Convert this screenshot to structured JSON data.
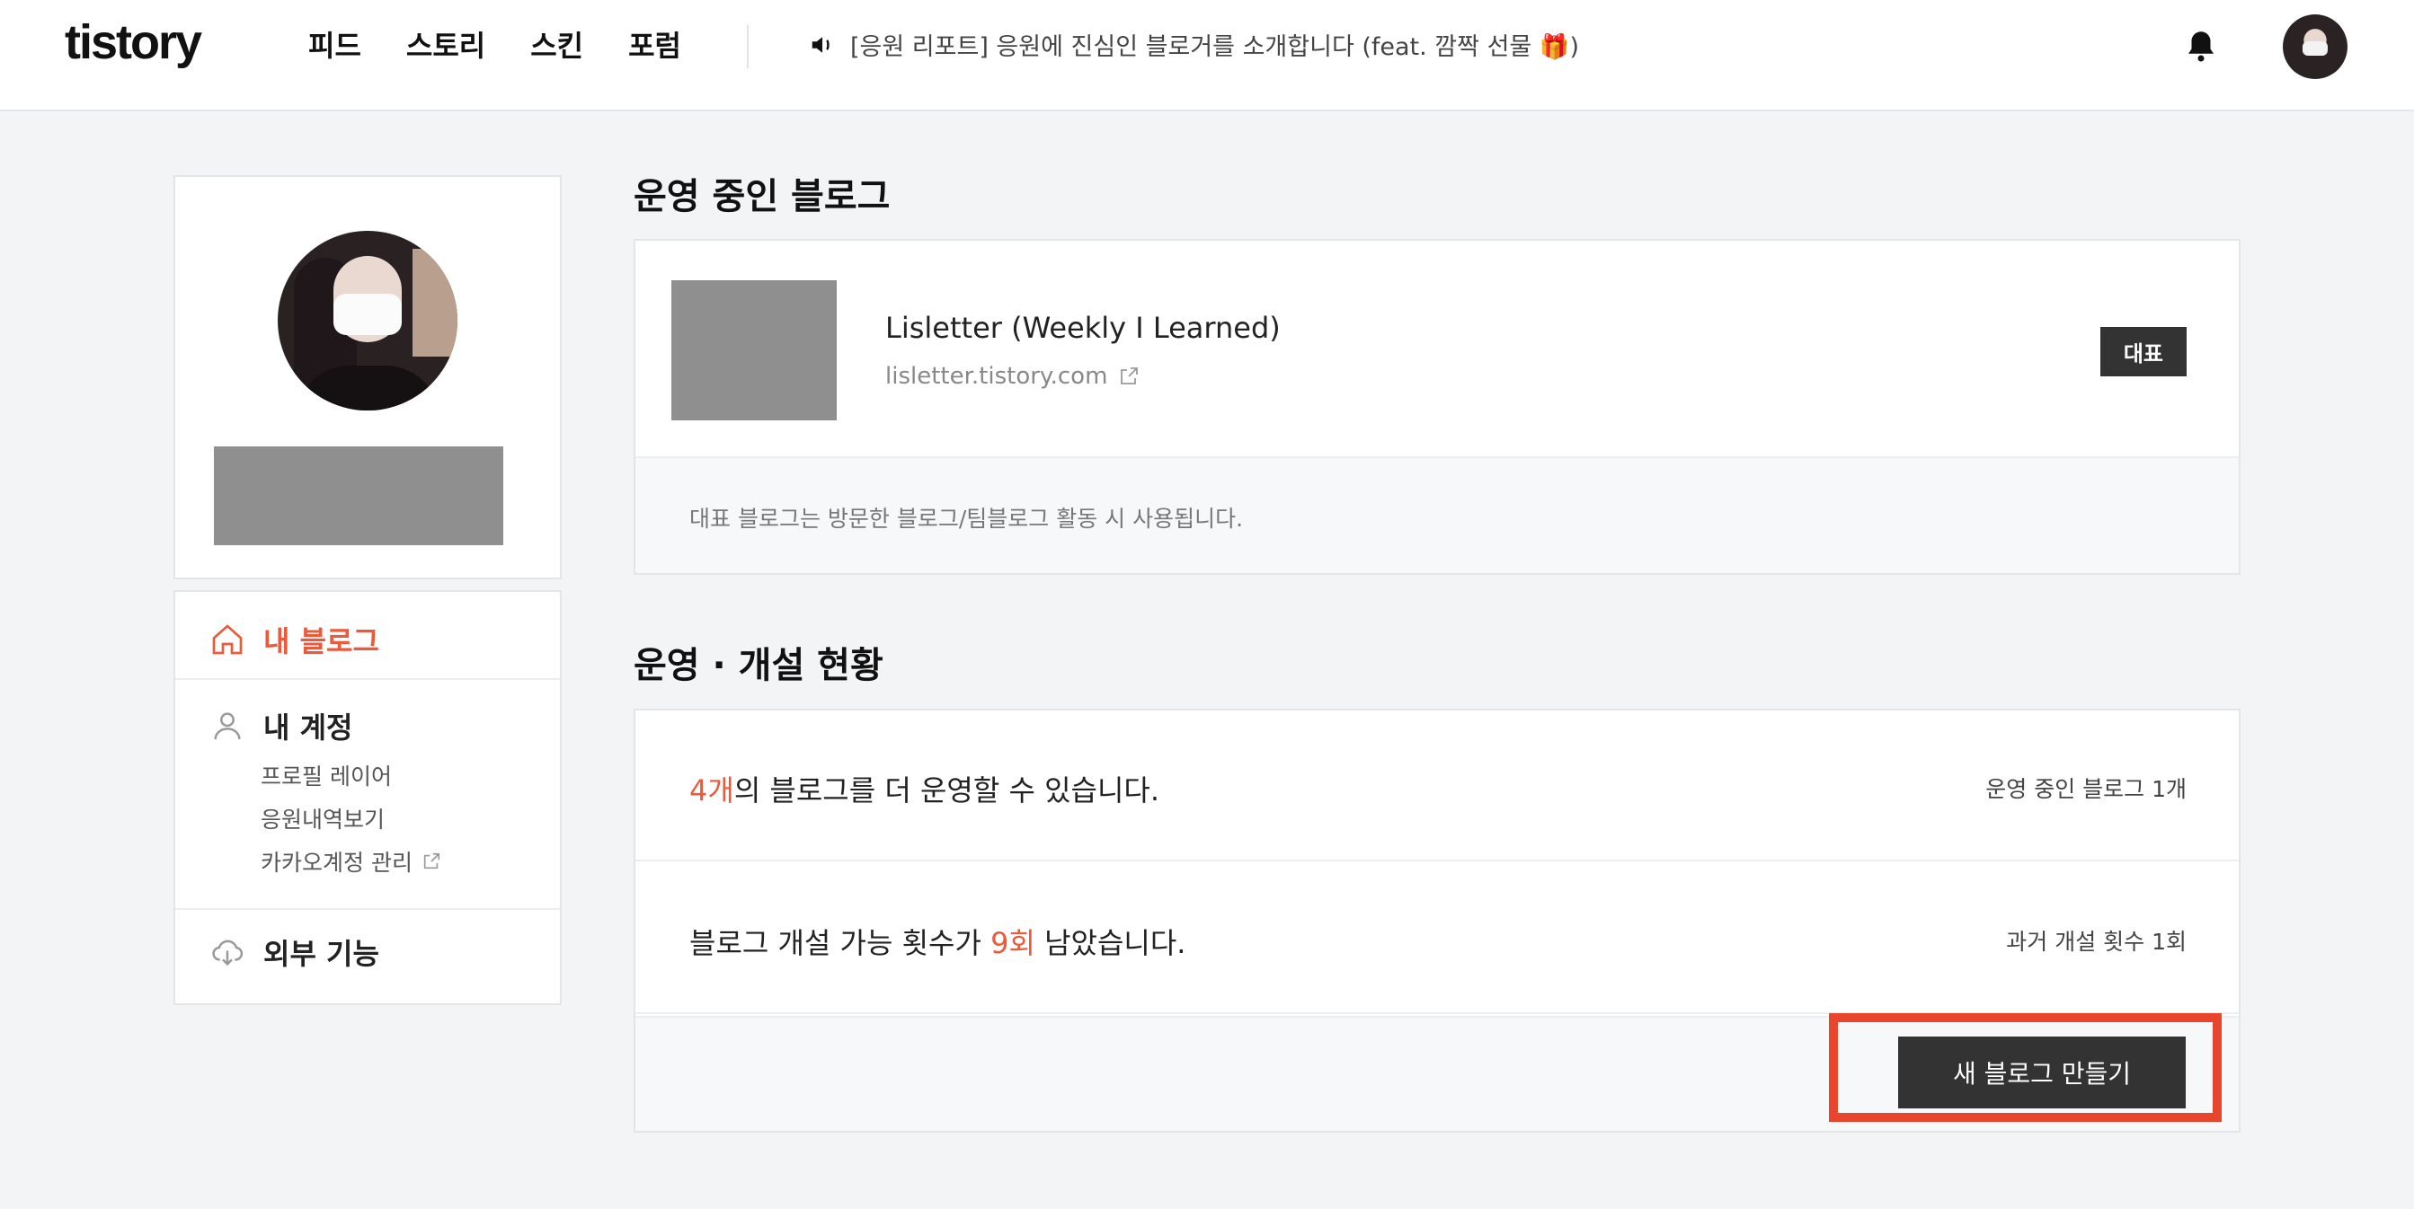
{
  "header": {
    "logo": "tistory",
    "nav": [
      "피드",
      "스토리",
      "스킨",
      "포럼"
    ],
    "notice": "[응원 리포트] 응원에 진심인 블로거를 소개합니다 (feat. 깜짝 선물 🎁)",
    "icons": {
      "speaker": "speaker-icon",
      "bell": "bell-icon"
    }
  },
  "sidebar": {
    "menu": {
      "my_blog": "내 블로그",
      "my_account": "내 계정",
      "account_links": [
        "프로필 레이어",
        "응원내역보기",
        "카카오계정 관리"
      ],
      "external": "외부 기능"
    },
    "active_color": "#eb5a3c"
  },
  "main": {
    "running_title": "운영 중인 블로그",
    "blog": {
      "name": "Lisletter (Weekly I Learned)",
      "url": "lisletter.tistory.com",
      "badge": "대표"
    },
    "rep_note": "대표 블로그는 방문한 블로그/팀블로그 활동 시 사용됩니다.",
    "status_title": "운영 · 개설 현황",
    "status": {
      "row1_highlight": "4개",
      "row1_text": "의 블로그를 더 운영할 수 있습니다.",
      "row1_side": "운영 중인 블로그 1개",
      "row2_prefix": "블로그 개설 가능 횟수가 ",
      "row2_highlight": "9회",
      "row2_suffix": " 남았습니다.",
      "row2_side": "과거 개설 횟수 1회"
    },
    "create_button": "새 블로그 만들기"
  },
  "colors": {
    "accent": "#eb5a3c",
    "dark_button": "#333333",
    "highlight_box": "#e8452c"
  }
}
